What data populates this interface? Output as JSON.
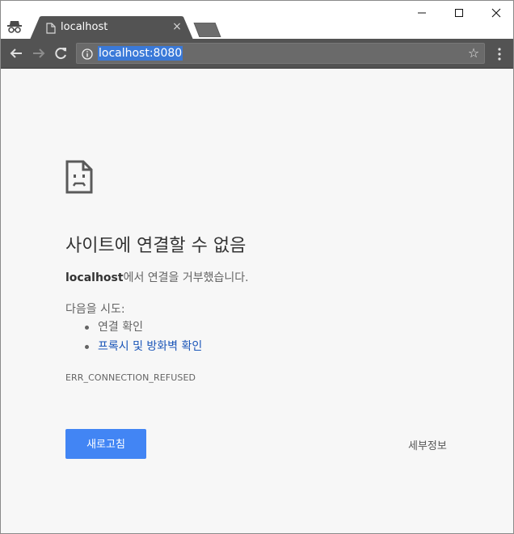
{
  "tab": {
    "title": "localhost",
    "close": "×"
  },
  "toolbar": {
    "url": "localhost:8080",
    "star": "☆"
  },
  "error": {
    "heading": "사이트에 연결할 수 없음",
    "host": "localhost",
    "message": "에서 연결을 거부했습니다.",
    "try_label": "다음을 시도:",
    "suggestions": [
      "연결 확인",
      "프록시 및 방화벽 확인"
    ],
    "code": "ERR_CONNECTION_REFUSED",
    "reload_label": "새로고침",
    "details_label": "세부정보"
  },
  "colors": {
    "accent": "#4285f4",
    "link": "#1a55b8",
    "toolbar": "#535353",
    "tab": "#535353",
    "url_highlight": "#3a79d8"
  }
}
